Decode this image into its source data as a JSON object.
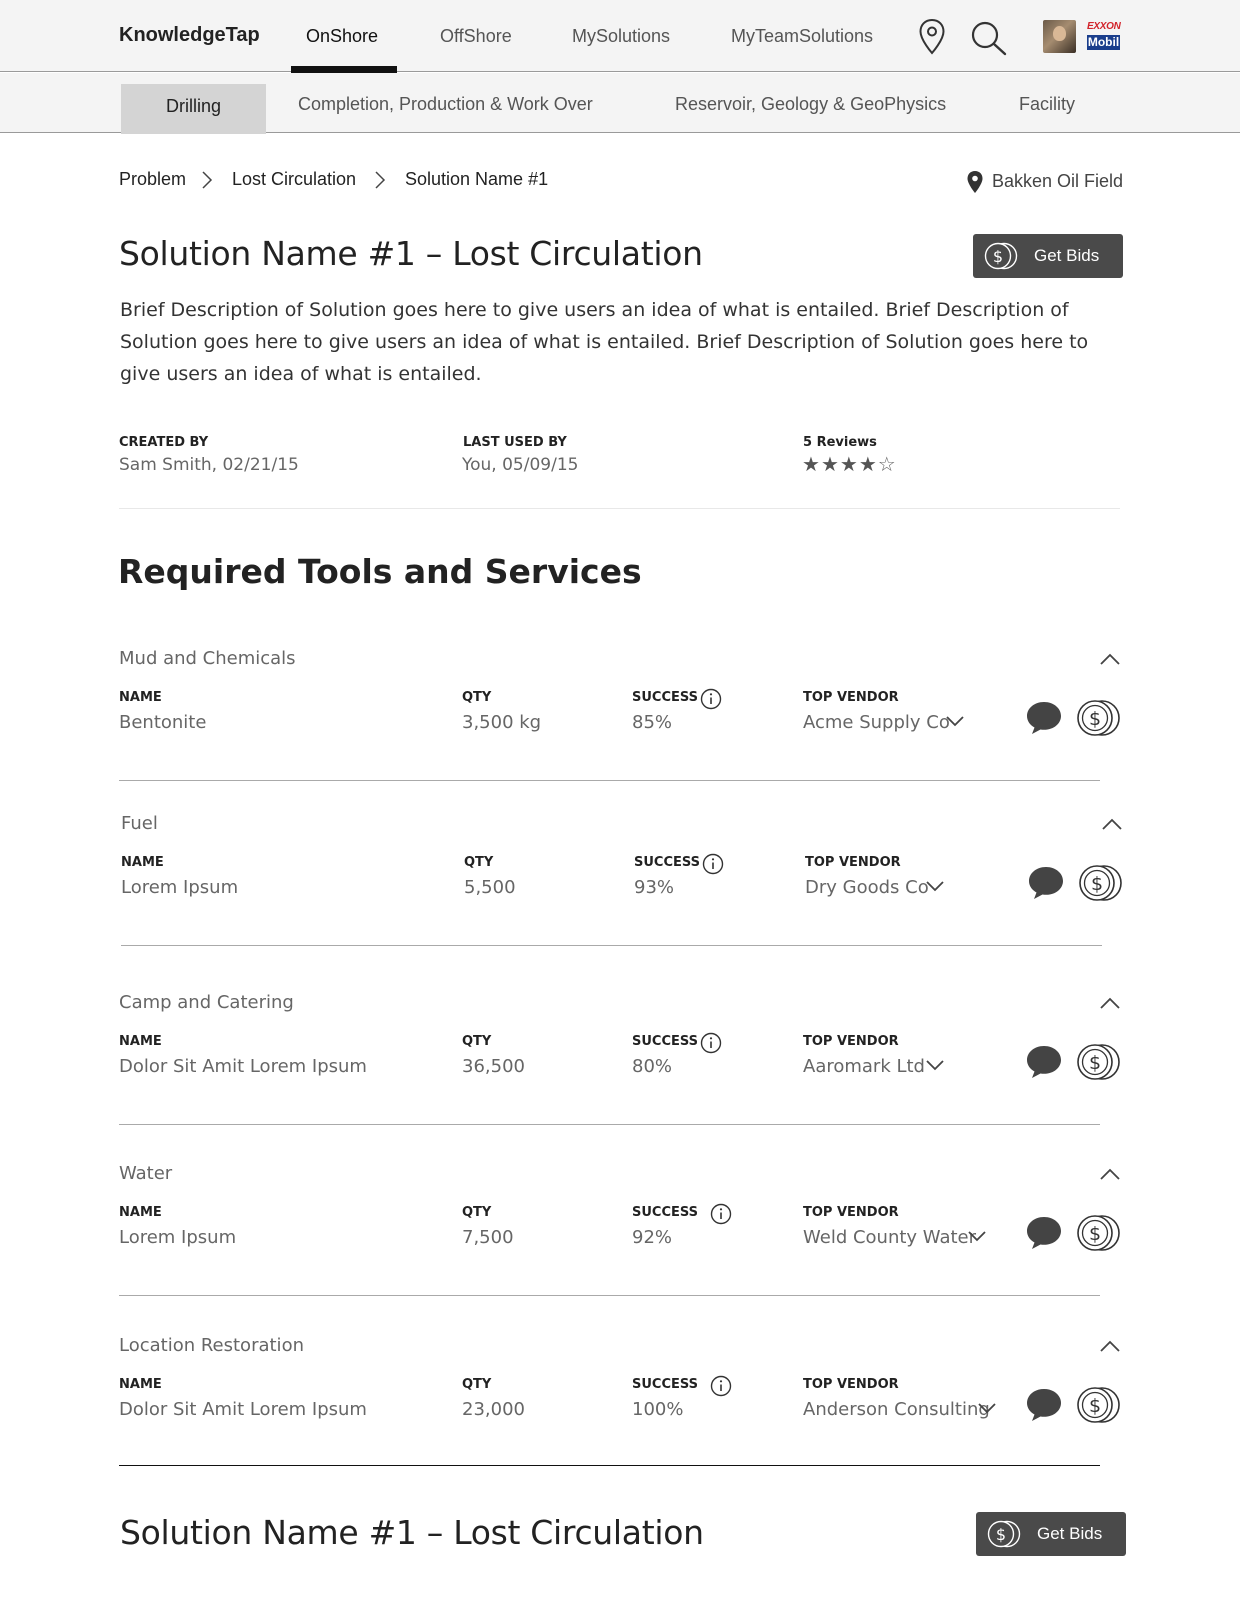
{
  "topnav": {
    "brand": "KnowledgeTap",
    "tabs": [
      "OnShore",
      "OffShore",
      "MySolutions",
      "MyTeamSolutions"
    ],
    "logo_top": "EXXON",
    "logo_bottom": "Mobil"
  },
  "subnav": {
    "tabs": [
      "Drilling",
      "Completion, Production & Work Over",
      "Reservoir, Geology & GeoPhysics",
      "Facility"
    ]
  },
  "breadcrumb": [
    "Problem",
    "Lost Circulation",
    "Solution Name #1"
  ],
  "location": "Bakken Oil Field",
  "solution": {
    "title": "Solution Name #1 – Lost Circulation",
    "get_bids_label": "Get Bids",
    "description": "Brief Description of Solution goes here to give users an idea of what is entailed. Brief Description of Solution goes here to give users an idea of what is entailed. Brief Description of Solution goes here to give users an idea of what is entailed.",
    "created_by_label": "CREATED BY",
    "created_by_value": "Sam Smith, 02/21/15",
    "last_used_label": "LAST USED BY",
    "last_used_value": "You, 05/09/15",
    "reviews_label": "5 Reviews",
    "rating": 4,
    "rating_max": 5
  },
  "section_title": "Required Tools and Services",
  "labels": {
    "name": "NAME",
    "qty": "QTY",
    "success": "SUCCESS",
    "vendor": "TOP VENDOR"
  },
  "items": [
    {
      "category": "Mud and Chemicals",
      "name": "Bentonite",
      "qty": "3,500 kg",
      "success": "85%",
      "vendor": "Acme Supply Co"
    },
    {
      "category": "Fuel",
      "name": "Lorem Ipsum",
      "qty": "5,500",
      "success": "93%",
      "vendor": "Dry Goods Co"
    },
    {
      "category": "Camp and Catering",
      "name": "Dolor Sit Amit Lorem Ipsum",
      "qty": "36,500",
      "success": "80%",
      "vendor": "Aaromark Ltd"
    },
    {
      "category": "Water",
      "name": "Lorem Ipsum",
      "qty": "7,500",
      "success": "92%",
      "vendor": "Weld County Water"
    },
    {
      "category": "Location Restoration",
      "name": "Dolor Sit Amit Lorem Ipsum",
      "qty": "23,000",
      "success": "100%",
      "vendor": "Anderson Consulting"
    }
  ],
  "footer_solution": {
    "title": "Solution Name #1 – Lost Circulation",
    "get_bids_label": "Get Bids"
  },
  "colors": {
    "button_bg": "#4a4a4a",
    "active_subtab": "#d4d4d4",
    "nav_bg": "#f4f4f4"
  }
}
